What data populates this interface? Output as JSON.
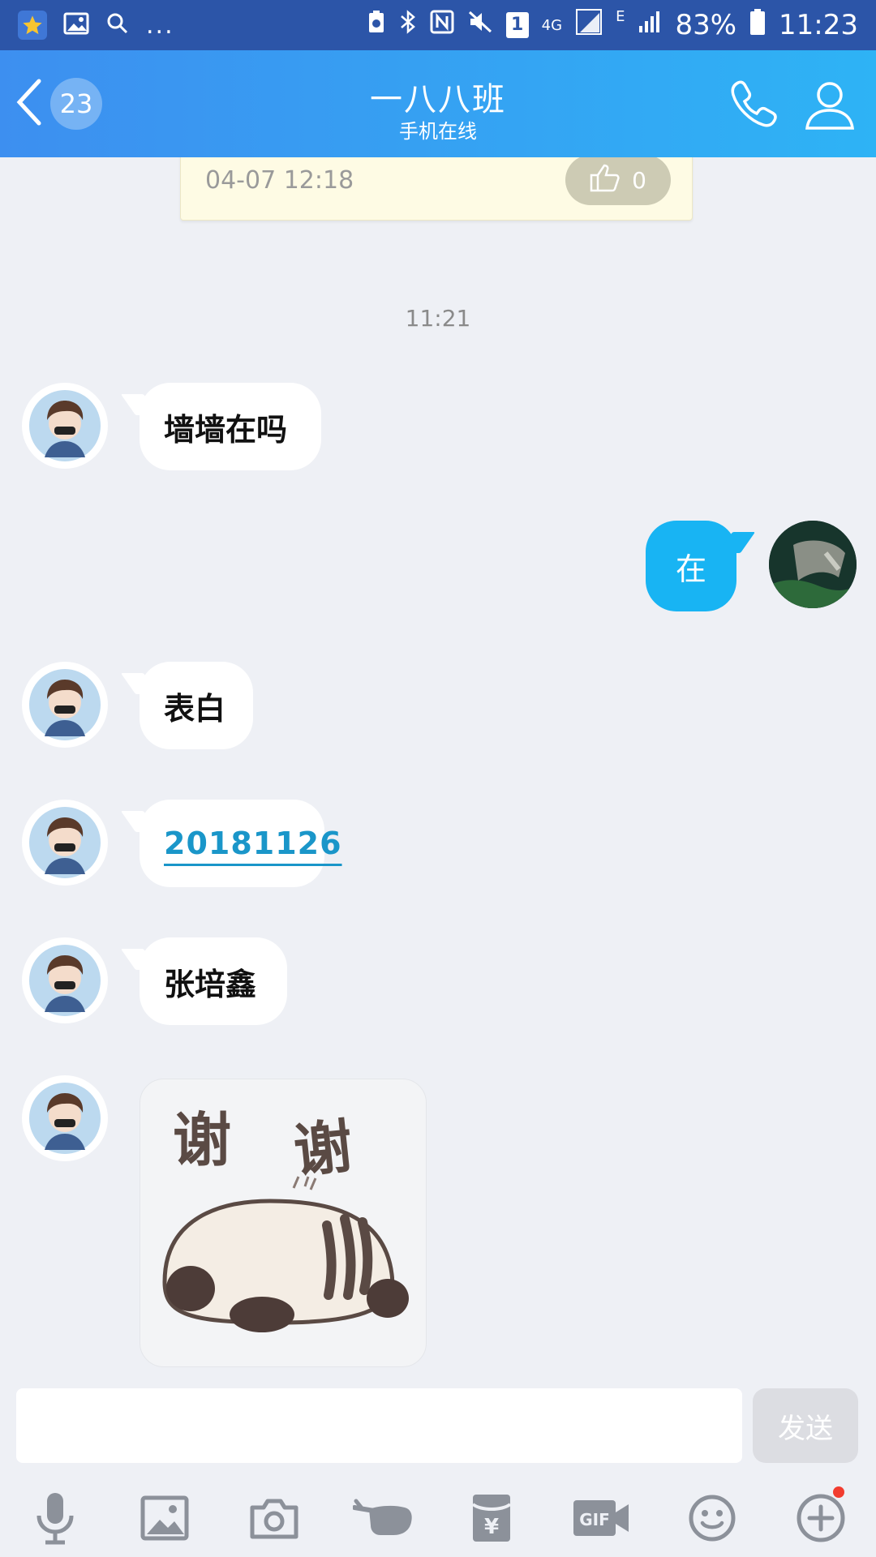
{
  "status_bar": {
    "ellipsis": "...",
    "sim": "1",
    "network": "4G",
    "network2": "E",
    "battery": "83%",
    "time": "11:23"
  },
  "header": {
    "unread_count": "23",
    "title": "一八八班",
    "subtitle": "手机在线"
  },
  "notice": {
    "time": "04-07 12:18",
    "like_count": "0"
  },
  "time_separator": "11:21",
  "messages": [
    {
      "text": "墙墙在吗",
      "from": "other"
    },
    {
      "text": "在",
      "from": "me"
    },
    {
      "text": "表白",
      "from": "other"
    },
    {
      "text": "20181126",
      "from": "other",
      "type": "link"
    },
    {
      "text": "张培鑫",
      "from": "other"
    }
  ],
  "sticker": {
    "text_left": "谢",
    "text_right": "谢"
  },
  "input": {
    "placeholder": "",
    "send_label": "发送"
  },
  "toolbar": {
    "gif_label": "GIF"
  },
  "colors": {
    "header_start": "#3d8ff0",
    "header_end": "#2eb3f5",
    "my_bubble": "#18b4f3",
    "link": "#1a96c9"
  }
}
